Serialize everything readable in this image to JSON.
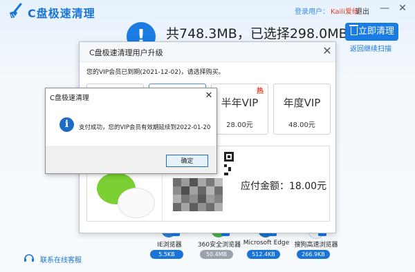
{
  "app": {
    "title": "C盘极速清理",
    "login_label": "登录用户：",
    "login_user": "Kaili爱绮",
    "logout": "退出",
    "minimize_glyph": "—",
    "close_glyph": "✕",
    "summary": "共748.3MB，已选择298.0MB",
    "clean_button": "立即清理",
    "rescan_link": "返回继续扫描",
    "contact": "联系在线客服",
    "accent_color": "#1a74d8"
  },
  "browsers": [
    {
      "name": "IE浏览器",
      "size": "5.5KB",
      "icon": "ie-browser-icon",
      "checked": true
    },
    {
      "name": "360安全浏览器",
      "size": "50.4MB",
      "icon": "360-browser-icon",
      "checked": true
    },
    {
      "name": "Microsoft Edge",
      "size": "512.4KB",
      "icon": "edge-browser-icon",
      "checked": true
    },
    {
      "name": "搜狗高速浏览器",
      "size": "266.9KB",
      "icon": "sogou-browser-icon",
      "checked": true
    }
  ],
  "upgrade_dialog": {
    "title": "C盘极速清理用户升级",
    "close_glyph": "✕",
    "expired_text": "您的VIP会员已到期(2021-12-02)，请选择购买。",
    "plans": [
      {
        "name": "",
        "price": ""
      },
      {
        "name": "",
        "price": ""
      },
      {
        "name": "半年VIP",
        "price": "28.00元",
        "badge": "热"
      },
      {
        "name": "年度VIP",
        "price": "48.00元",
        "badge": ""
      }
    ],
    "amount_label": "应付金额：18.00元"
  },
  "message_box": {
    "title": "C盘极速清理",
    "close_glyph": "✕",
    "icon": "info-icon",
    "text": "支付成功，您的VIP会员有效期延续到2022-01-20",
    "ok_button": "确定"
  }
}
